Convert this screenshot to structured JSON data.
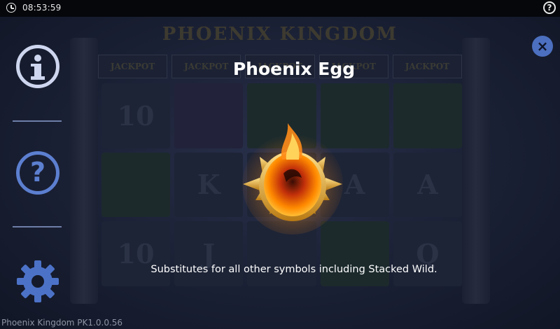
{
  "status_bar": {
    "time": "08:53:59",
    "clock_icon": "clock-icon",
    "help_icon": "help-circle-icon",
    "help_glyph": "?"
  },
  "background": {
    "game_title": "PHOENIX KINGDOM",
    "jackpot_labels": [
      "JACKPOT",
      "JACKPOT",
      "JACKPOT",
      "JACKPOT",
      "JACKPOT"
    ],
    "reel_symbols": [
      "10",
      "",
      "",
      "",
      "",
      "",
      "K",
      "",
      "A",
      "A",
      "10",
      "J",
      "",
      "",
      "Q"
    ]
  },
  "side_menu": {
    "info_icon": "info-circle-icon",
    "help_icon": "question-circle-icon",
    "help_glyph": "?",
    "settings_icon": "gear-icon"
  },
  "dialog": {
    "close_icon": "close-icon",
    "close_glyph": "×",
    "symbol_name": "Phoenix Egg",
    "symbol_image": "phoenix-egg-icon",
    "description": "Substitutes for all other symbols including Stacked Wild."
  },
  "footer": {
    "version": "Phoenix Kingdom PK1.0.0.56"
  },
  "colors": {
    "overlay_bg": "#1a2034",
    "menu_accent": "#5c7fd0",
    "info_icon": "#cdd6ee",
    "close_button": "#4c6fbf"
  }
}
